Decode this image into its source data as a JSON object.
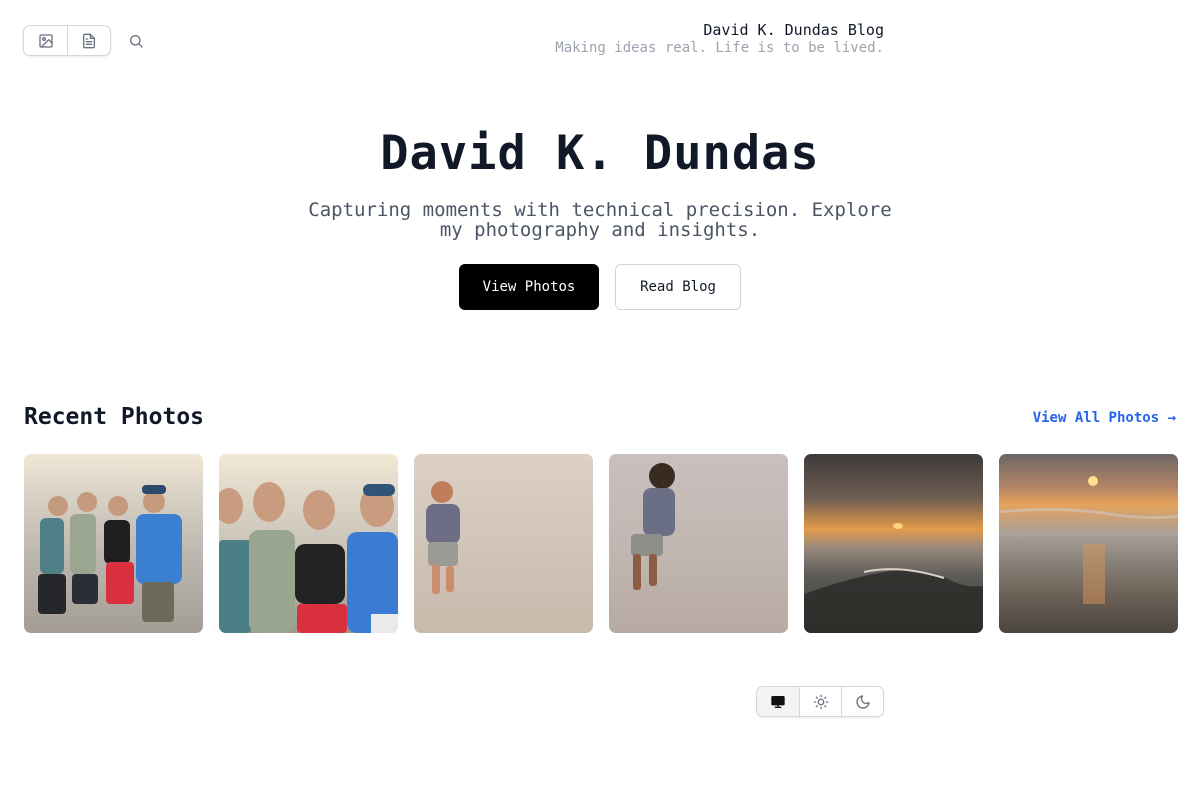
{
  "topbar": {
    "nav_icons": [
      "image-icon",
      "document-icon"
    ],
    "search_icon": "search-icon"
  },
  "site": {
    "title": "David K. Dundas Blog",
    "tagline": "Making ideas real. Life is to be lived."
  },
  "hero": {
    "title": "David K. Dundas",
    "subtitle": "Capturing moments with technical precision. Explore my photography and insights.",
    "primary_label": "View Photos",
    "secondary_label": "Read Blog"
  },
  "recent": {
    "heading": "Recent Photos",
    "view_all": "View All Photos →",
    "photos": [
      {
        "subject": "group-of-four-on-beach"
      },
      {
        "subject": "group-closeup-on-beach"
      },
      {
        "subject": "toddler-walking-on-sand"
      },
      {
        "subject": "toddler-running-on-sand"
      },
      {
        "subject": "sunset-over-ocean"
      },
      {
        "subject": "sunset-reflection-on-shore"
      }
    ]
  },
  "theme": {
    "options": [
      "monitor-icon",
      "sun-icon",
      "moon-icon"
    ],
    "active": "monitor-icon"
  },
  "colors": {
    "primary_button": "#000000",
    "link": "#2563eb",
    "muted": "#9ca3af"
  }
}
